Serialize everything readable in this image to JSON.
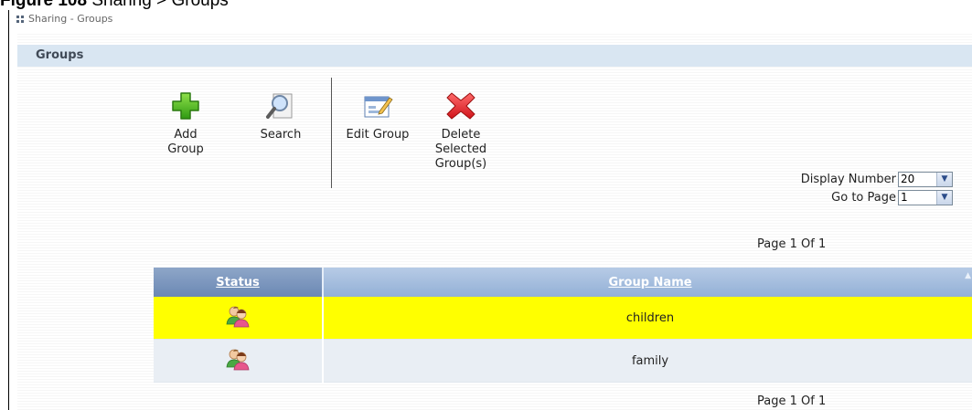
{
  "caption": {
    "prefix": "Figure 108",
    "text": "Sharing > Groups"
  },
  "breadcrumb": {
    "text": "Sharing - Groups"
  },
  "section": {
    "title": "Groups"
  },
  "toolbar": {
    "add": {
      "label_line1": "Add",
      "label_line2": "Group"
    },
    "search": {
      "label": "Search"
    },
    "edit": {
      "label": "Edit Group"
    },
    "delete": {
      "label_line1": "Delete",
      "label_line2": "Selected",
      "label_line3": "Group(s)"
    }
  },
  "options": {
    "display_number": {
      "label": "Display Number",
      "value": "20"
    },
    "go_to_page": {
      "label": "Go to Page",
      "value": "1"
    }
  },
  "pager": {
    "text": "Page 1 Of 1"
  },
  "table": {
    "headers": {
      "status": "Status",
      "group_name": "Group Name"
    },
    "rows": [
      {
        "status_icon": "group-users-icon",
        "group_name": "children",
        "selected": true
      },
      {
        "status_icon": "group-users-icon",
        "group_name": "family",
        "selected": false
      }
    ]
  },
  "colors": {
    "selected_row": "#ffff00",
    "section_bar": "#d9e6f2",
    "header_status": "#7f98be",
    "header_name": "#a8bfde"
  }
}
